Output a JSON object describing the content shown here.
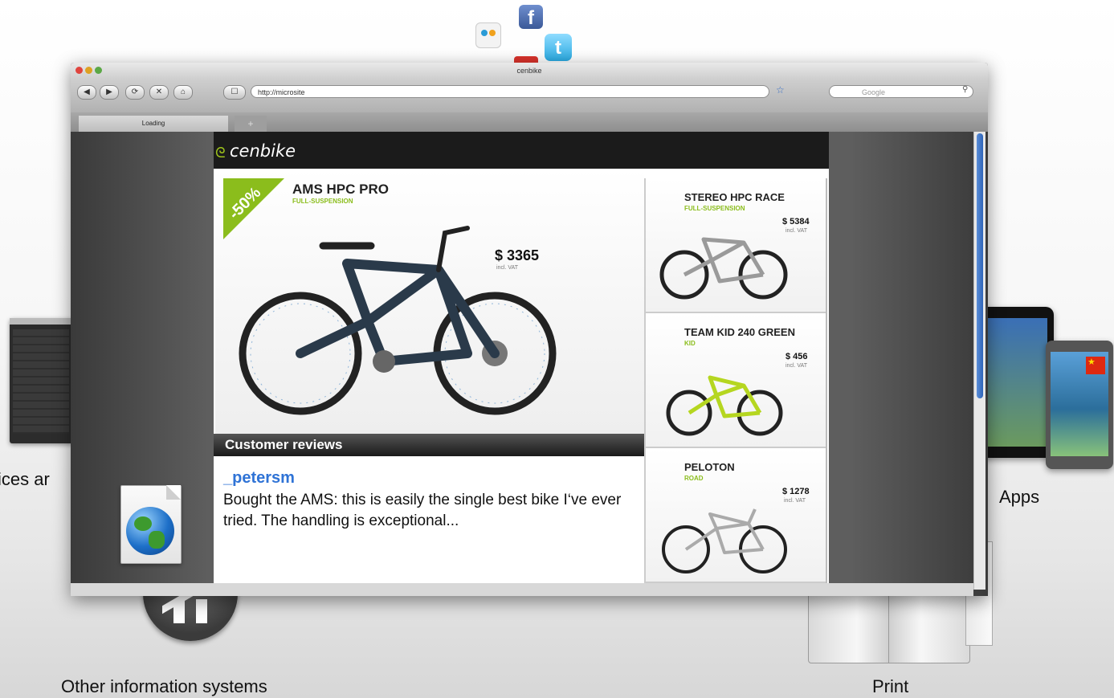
{
  "captions": {
    "left_partial": "vices ar",
    "apps": "Apps",
    "other_systems": "Other information systems",
    "print": "Print"
  },
  "browser": {
    "title": "cenbike",
    "url": "http://microsite",
    "search_placeholder": "Google",
    "tab_label": "Loading"
  },
  "site": {
    "brand": "cenbike",
    "hero": {
      "badge": "-50%",
      "title": "AMS HPC PRO",
      "subtitle": "FULL-SUSPENSION",
      "price": "$ 3365",
      "vat": "incl. VAT"
    },
    "reviews": {
      "heading": "Customer reviews",
      "author": "_petersm",
      "text": "Bought the AMS: this is easily the single best bike I‘ve ever tried. The handling is exceptional..."
    },
    "products": [
      {
        "name": "STEREO HPC RACE",
        "category": "FULL-SUSPENSION",
        "price": "$ 5384",
        "vat": "incl. VAT"
      },
      {
        "name": "TEAM KID 240 GREEN",
        "category": "KID",
        "price": "$ 456",
        "vat": "incl. VAT"
      },
      {
        "name": "PELOTON",
        "category": "ROAD",
        "price": "$ 1278",
        "vat": "incl. VAT"
      }
    ]
  },
  "colors": {
    "accent_green": "#8bbd1c",
    "link_blue": "#2f73d6",
    "header_dark": "#1b1b1b"
  }
}
